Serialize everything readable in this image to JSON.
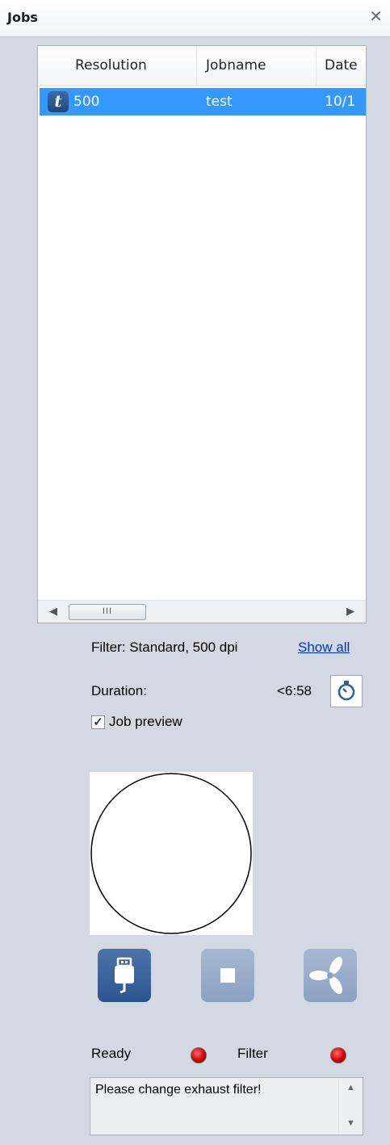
{
  "panel": {
    "title": "Jobs",
    "close_glyph": "✕"
  },
  "job_table": {
    "columns": [
      "Resolution",
      "Jobname",
      "Date"
    ],
    "rows": [
      {
        "icon": "t",
        "resolution": "500",
        "jobname": "test",
        "date": "10/1"
      }
    ],
    "scroll_thumb_glyph": "III"
  },
  "filter": {
    "label": "Filter: Standard, 500 dpi",
    "show_all": "Show all"
  },
  "duration": {
    "label": "Duration:",
    "value": "<6:58"
  },
  "job_preview": {
    "label": "Job preview",
    "checked": true
  },
  "status": {
    "ready_label": "Ready",
    "filter_label": "Filter",
    "ready_color": "#d10000",
    "filter_color": "#d10000"
  },
  "message": {
    "text": "Please change exhaust filter!"
  },
  "icons": {
    "usb": "usb-plug-icon",
    "stop": "stop-icon",
    "fan": "fan-icon",
    "timer": "timer-icon"
  }
}
